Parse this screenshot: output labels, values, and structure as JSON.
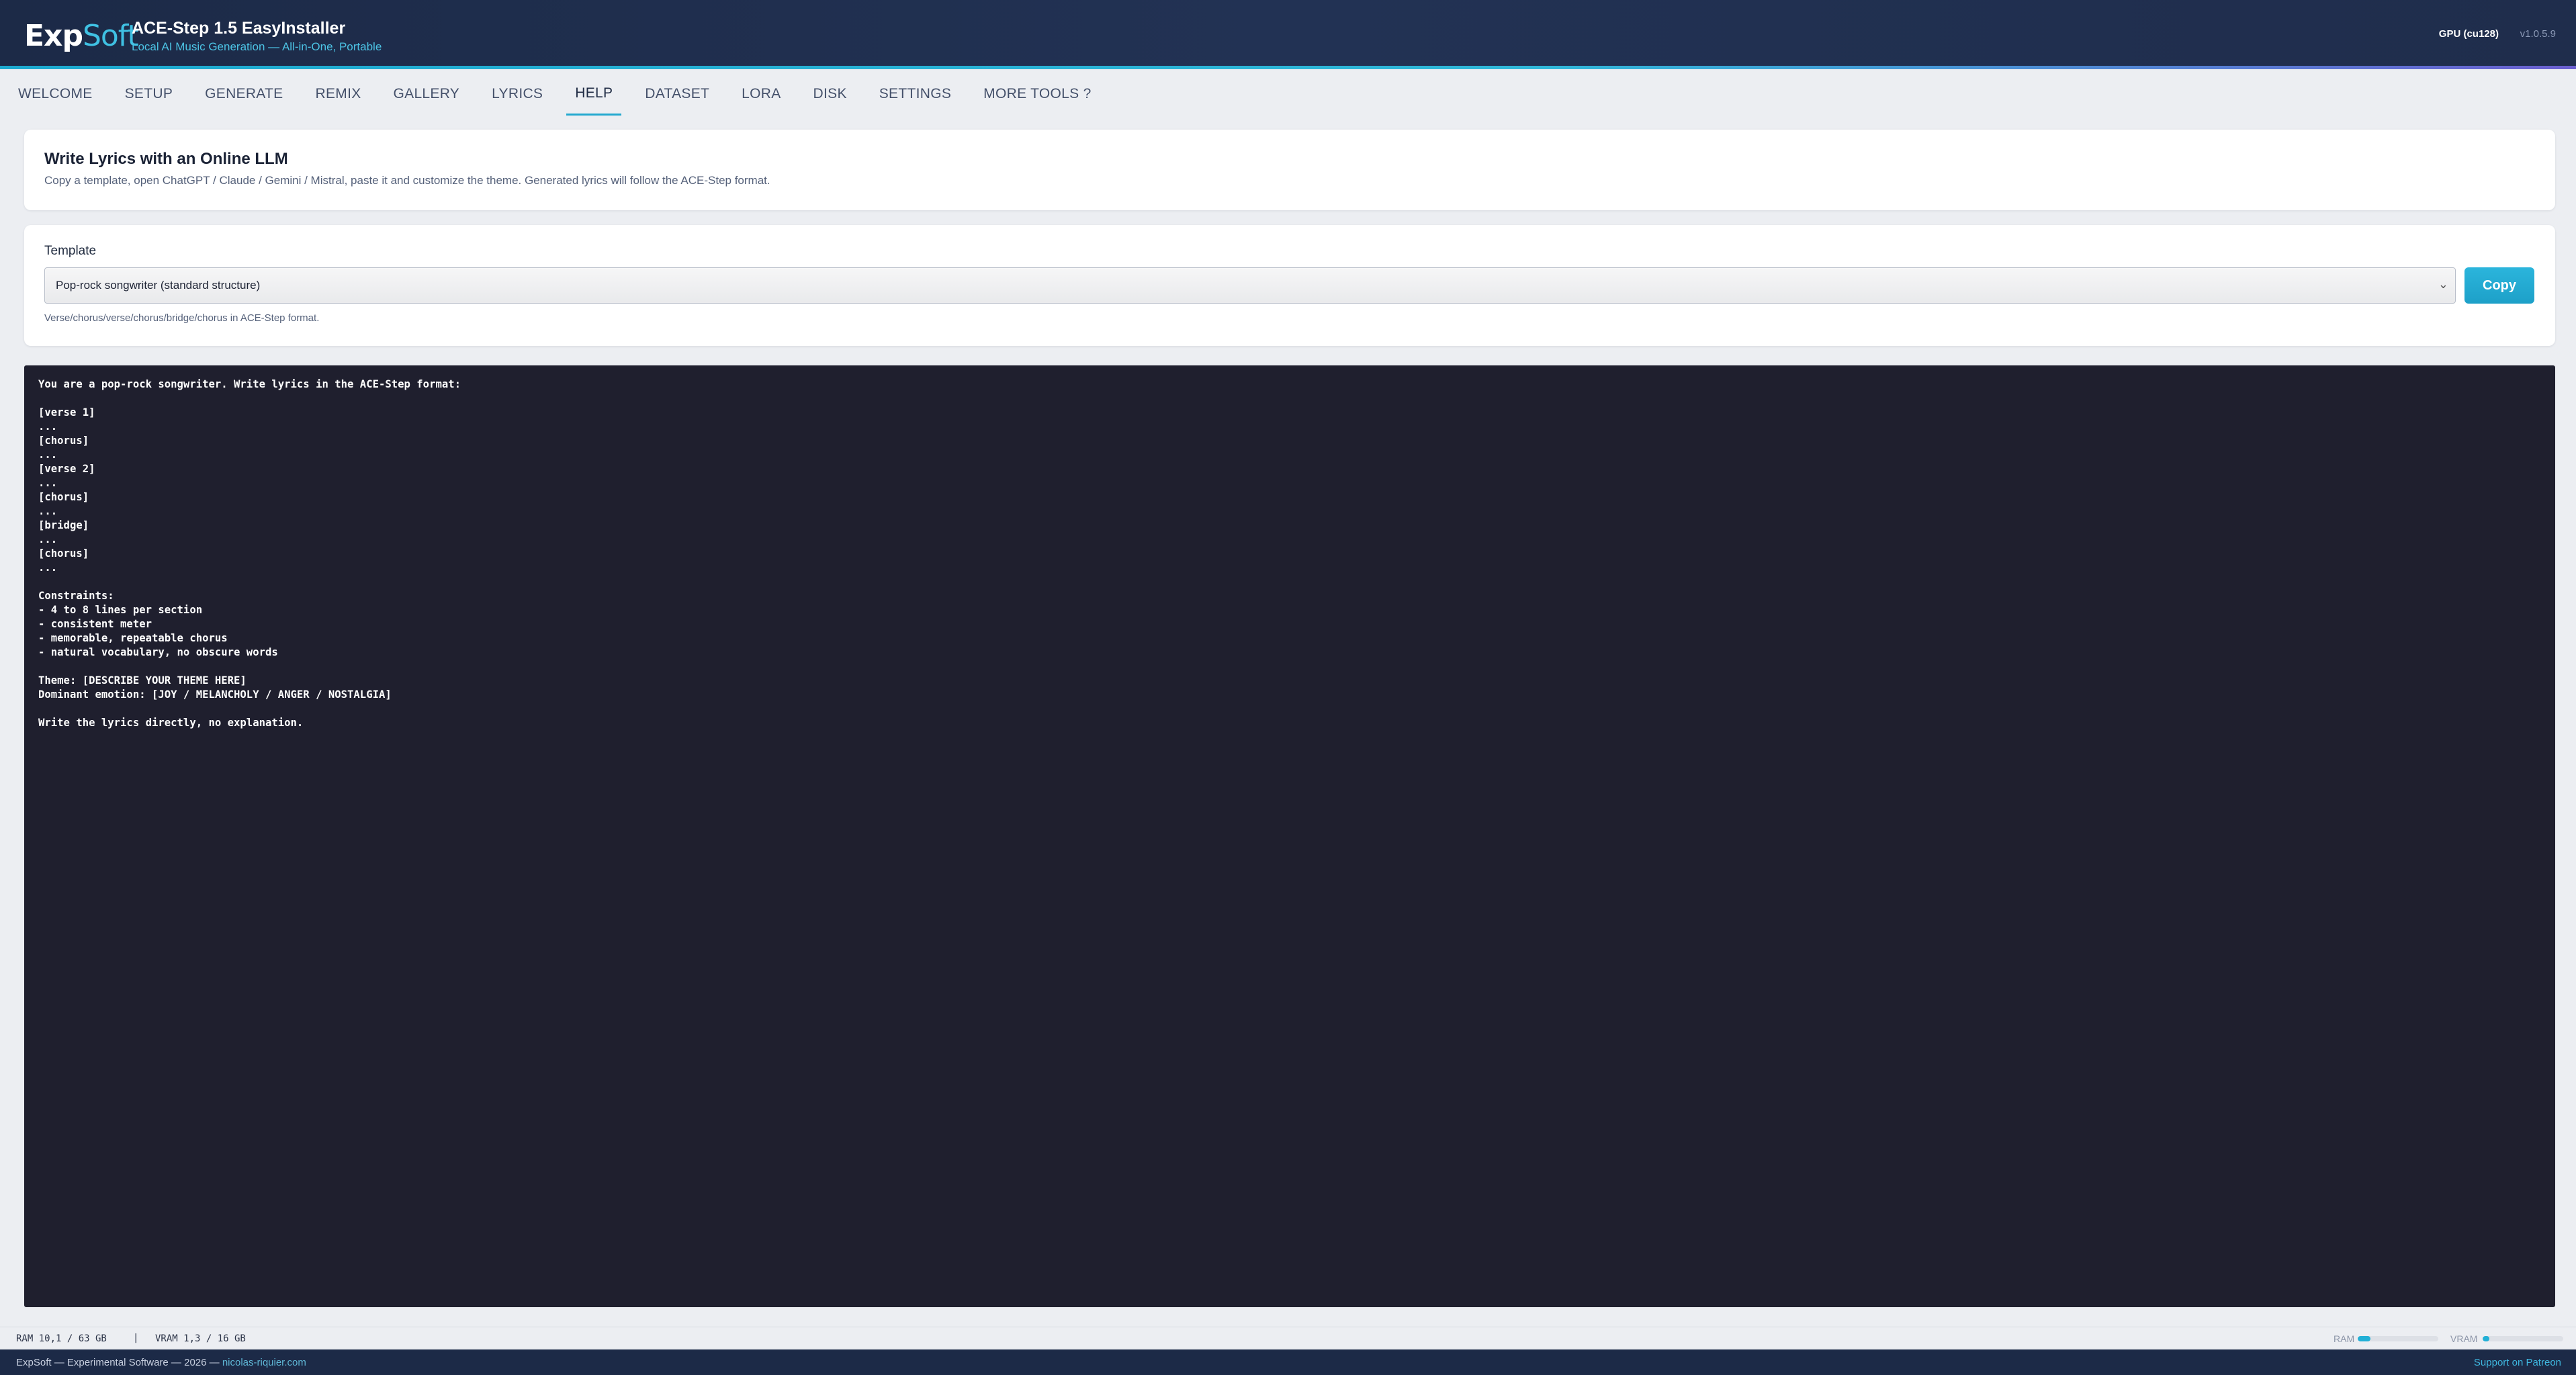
{
  "header": {
    "logo_exp": "Exp",
    "logo_soft": "Soft",
    "app_title": "ACE-Step 1.5 EasyInstaller",
    "app_subtitle": "Local AI Music Generation — All-in-One, Portable",
    "gpu_badge": "GPU (cu128)",
    "version": "v1.0.5.9"
  },
  "tabs": [
    {
      "label": "WELCOME"
    },
    {
      "label": "SETUP"
    },
    {
      "label": "GENERATE"
    },
    {
      "label": "REMIX"
    },
    {
      "label": "GALLERY"
    },
    {
      "label": "LYRICS"
    },
    {
      "label": "HELP",
      "active": true
    },
    {
      "label": "DATASET"
    },
    {
      "label": "LORA"
    },
    {
      "label": "DISK"
    },
    {
      "label": "SETTINGS"
    },
    {
      "label": "MORE TOOLS ?"
    }
  ],
  "intro": {
    "title": "Write Lyrics with an Online LLM",
    "description": "Copy a template, open ChatGPT / Claude / Gemini / Mistral, paste it and customize the theme. Generated lyrics will follow the ACE-Step format."
  },
  "template": {
    "label": "Template",
    "selected": "Pop-rock songwriter (standard structure)",
    "copy_label": "Copy",
    "hint": "Verse/chorus/verse/chorus/bridge/chorus in ACE-Step format."
  },
  "prompt_text": "You are a pop-rock songwriter. Write lyrics in the ACE-Step format:\n\n[verse 1]\n...\n[chorus]\n...\n[verse 2]\n...\n[chorus]\n...\n[bridge]\n...\n[chorus]\n...\n\nConstraints:\n- 4 to 8 lines per section\n- consistent meter\n- memorable, repeatable chorus\n- natural vocabulary, no obscure words\n\nTheme: [DESCRIBE YOUR THEME HERE]\nDominant emotion: [JOY / MELANCHOLY / ANGER / NOSTALGIA]\n\nWrite the lyrics directly, no explanation.",
  "status": {
    "ram_text": "RAM 10,1 / 63 GB",
    "separator": "|",
    "vram_text": "VRAM 1,3 / 16 GB",
    "ram_label": "RAM",
    "vram_label": "VRAM",
    "ram_fraction": 0.16,
    "vram_fraction": 0.08
  },
  "footer": {
    "text": "ExpSoft — Experimental Software — 2026 — ",
    "link": "nicolas-riquier.com",
    "support": "Support on Patreon"
  },
  "colors": {
    "accent": "#22b0d6",
    "header_bg": "#1c2a47",
    "code_bg": "#1f1f2e"
  }
}
